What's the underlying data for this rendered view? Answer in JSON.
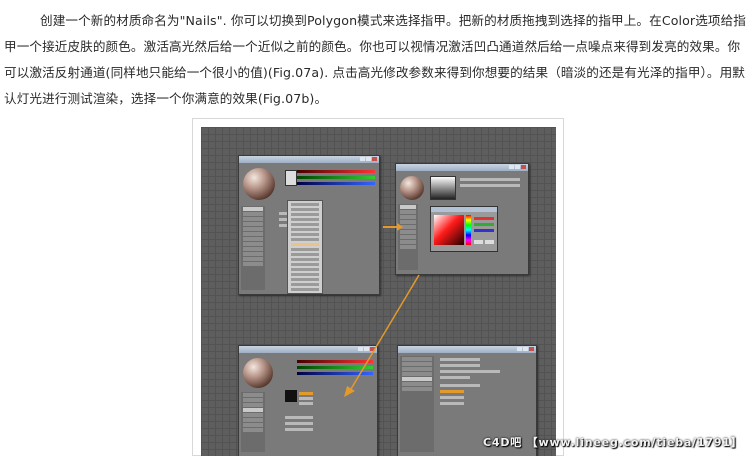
{
  "article": {
    "paragraph": "创建一个新的材质命名为\"Nails\". 你可以切换到Polygon模式来选择指甲。把新的材质拖拽到选择的指甲上。在Color选项给指甲一个接近皮肤的颜色。激活高光然后给一个近似之前的颜色。你也可以视情况激活凹凸通道然后给一点噪点来得到发亮的效果。你可以激活反射通道(同样地只能给一个很小的值)(Fig.07a). 点击高光修改参数来得到你想要的结果（暗淡的还是有光泽的指甲）。用默认灯光进行测试渲染，选择一个你满意的效果(Fig.07b)。"
  },
  "figure": {
    "watermark": "C4D吧 【www.lineeg.com/tieba/1791】",
    "colors": {
      "background": "#5e5e5e",
      "arrow": "#e39a2b",
      "titlebar": "#a9b9cc"
    }
  }
}
